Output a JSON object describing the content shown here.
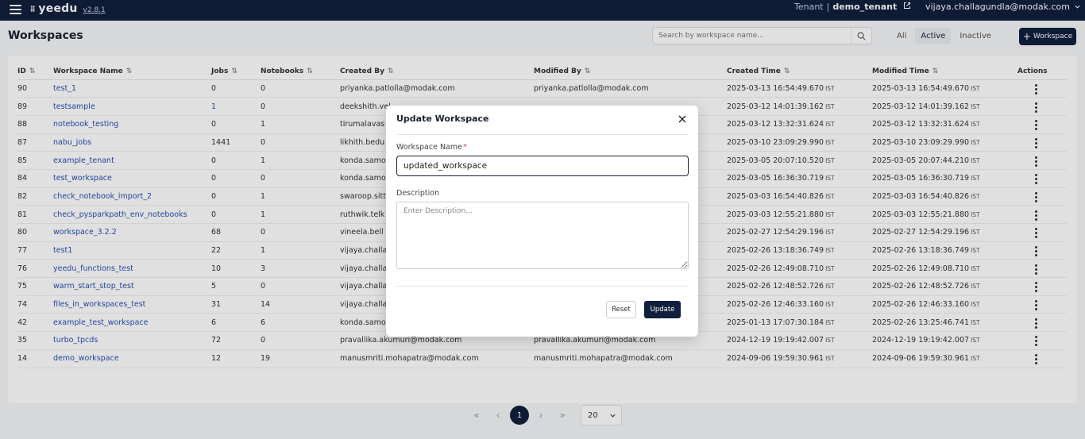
{
  "topbar": {
    "app_name": "yeedu",
    "version": "v2.8.1",
    "tenant_label": "Tenant",
    "tenant_sep": "|",
    "tenant_name": "demo_tenant",
    "user_email": "vijaya.challagundla@modak.com"
  },
  "page": {
    "title": "Workspaces",
    "search_placeholder": "Search by workspace name...",
    "filters": [
      "All",
      "Active",
      "Inactive"
    ],
    "active_filter": "Active",
    "add_button": "Workspace"
  },
  "table": {
    "columns": [
      "ID",
      "Workspace Name",
      "Jobs",
      "Notebooks",
      "Created By",
      "Modified By",
      "Created Time",
      "Modified Time",
      "Actions"
    ],
    "rows": [
      {
        "id": "90",
        "name": "test_1",
        "jobs": "0",
        "notebooks": "0",
        "created_by": "priyanka.patlolla@modak.com",
        "modified_by": "priyanka.patlolla@modak.com",
        "created_time": "2025-03-13 16:54:49.670",
        "modified_time": "2025-03-13 16:54:49.670",
        "tz": "IST"
      },
      {
        "id": "89",
        "name": "testsample",
        "jobs": "1",
        "notebooks": "0",
        "created_by": "deekshith.vel",
        "modified_by": "",
        "created_time": "2025-03-12 14:01:39.162",
        "modified_time": "2025-03-12 14:01:39.162",
        "tz": "IST"
      },
      {
        "id": "88",
        "name": "notebook_testing",
        "jobs": "0",
        "notebooks": "1",
        "created_by": "tirumalavas",
        "modified_by": "",
        "created_time": "2025-03-12 13:32:31.624",
        "modified_time": "2025-03-12 13:32:31.624",
        "tz": "IST"
      },
      {
        "id": "87",
        "name": "nabu_jobs",
        "jobs": "1441",
        "notebooks": "0",
        "created_by": "likhith.bedu",
        "modified_by": "",
        "created_time": "2025-03-10 23:09:29.990",
        "modified_time": "2025-03-10 23:09:29.990",
        "tz": "IST"
      },
      {
        "id": "85",
        "name": "example_tenant",
        "jobs": "0",
        "notebooks": "1",
        "created_by": "konda.samo",
        "modified_by": "",
        "created_time": "2025-03-05 20:07:10.520",
        "modified_time": "2025-03-05 20:07:44.210",
        "tz": "IST"
      },
      {
        "id": "84",
        "name": "test_workspace",
        "jobs": "0",
        "notebooks": "0",
        "created_by": "konda.samo",
        "modified_by": "",
        "created_time": "2025-03-05 16:36:30.719",
        "modified_time": "2025-03-05 16:36:30.719",
        "tz": "IST"
      },
      {
        "id": "82",
        "name": "check_notebook_import_2",
        "jobs": "0",
        "notebooks": "1",
        "created_by": "swaroop.sitt",
        "modified_by": "",
        "created_time": "2025-03-03 16:54:40.826",
        "modified_time": "2025-03-03 16:54:40.826",
        "tz": "IST"
      },
      {
        "id": "81",
        "name": "check_pysparkpath_env_notebooks",
        "jobs": "0",
        "notebooks": "1",
        "created_by": "ruthwik.telk",
        "modified_by": "",
        "created_time": "2025-03-03 12:55:21.880",
        "modified_time": "2025-03-03 12:55:21.880",
        "tz": "IST"
      },
      {
        "id": "80",
        "name": "workspace_3.2.2",
        "jobs": "68",
        "notebooks": "0",
        "created_by": "vineela.bell",
        "modified_by": "",
        "created_time": "2025-02-27 12:54:29.196",
        "modified_time": "2025-02-27 12:54:29.196",
        "tz": "IST"
      },
      {
        "id": "77",
        "name": "test1",
        "jobs": "22",
        "notebooks": "1",
        "created_by": "vijaya.challa",
        "modified_by": "",
        "created_time": "2025-02-26 13:18:36.749",
        "modified_time": "2025-02-26 13:18:36.749",
        "tz": "IST"
      },
      {
        "id": "76",
        "name": "yeedu_functions_test",
        "jobs": "10",
        "notebooks": "3",
        "created_by": "vijaya.challa",
        "modified_by": "",
        "created_time": "2025-02-26 12:49:08.710",
        "modified_time": "2025-02-26 12:49:08.710",
        "tz": "IST"
      },
      {
        "id": "75",
        "name": "warm_start_stop_test",
        "jobs": "5",
        "notebooks": "0",
        "created_by": "vijaya.challa",
        "modified_by": "",
        "created_time": "2025-02-26 12:48:52.726",
        "modified_time": "2025-02-26 12:48:52.726",
        "tz": "IST"
      },
      {
        "id": "74",
        "name": "files_in_workspaces_test",
        "jobs": "31",
        "notebooks": "14",
        "created_by": "vijaya.challa",
        "modified_by": "",
        "created_time": "2025-02-26 12:46:33.160",
        "modified_time": "2025-02-26 12:46:33.160",
        "tz": "IST"
      },
      {
        "id": "42",
        "name": "example_test_workspace",
        "jobs": "6",
        "notebooks": "6",
        "created_by": "konda.samo",
        "modified_by": "",
        "created_time": "2025-01-13 17:07:30.184",
        "modified_time": "2025-02-26 13:25:46.741",
        "tz": "IST"
      },
      {
        "id": "35",
        "name": "turbo_tpcds",
        "jobs": "72",
        "notebooks": "0",
        "created_by": "pravallika.akumuri@modak.com",
        "modified_by": "pravallika.akumuri@modak.com",
        "created_time": "2024-12-19 19:19:42.007",
        "modified_time": "2024-12-19 19:19:42.007",
        "tz": "IST"
      },
      {
        "id": "14",
        "name": "demo_workspace",
        "jobs": "12",
        "notebooks": "19",
        "created_by": "manusmriti.mohapatra@modak.com",
        "modified_by": "manusmriti.mohapatra@modak.com",
        "created_time": "2024-09-06 19:59:30.961",
        "modified_time": "2024-09-06 19:59:30.961",
        "tz": "IST"
      }
    ]
  },
  "pagination": {
    "first": "«",
    "prev": "‹",
    "current": "1",
    "next": "›",
    "last": "»",
    "page_size": "20"
  },
  "modal": {
    "title": "Update Workspace",
    "name_label": "Workspace Name",
    "required_mark": "*",
    "name_value": "updated_workspace",
    "description_label": "Description",
    "description_placeholder": "Enter Description...",
    "reset_label": "Reset",
    "update_label": "Update"
  },
  "colors": {
    "primary": "#0f1f3d",
    "link": "#2850b8",
    "required": "#d9363e"
  }
}
